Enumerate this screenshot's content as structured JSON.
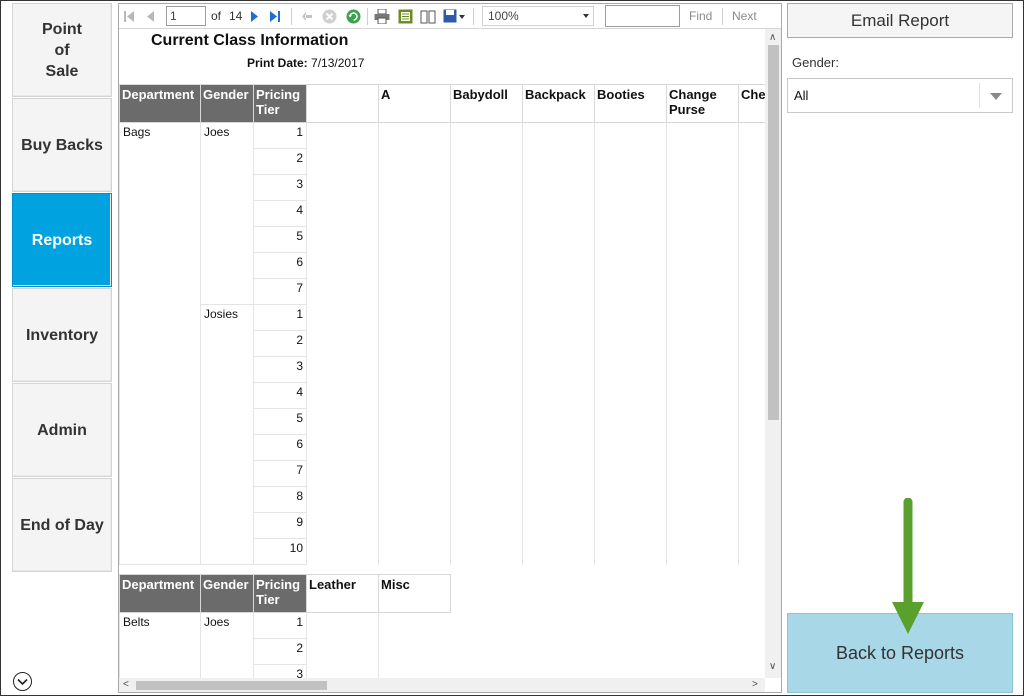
{
  "nav": {
    "items": [
      {
        "label": "Point\nof\nSale",
        "active": false
      },
      {
        "label": "Buy Backs",
        "active": false
      },
      {
        "label": "Reports",
        "active": true
      },
      {
        "label": "Inventory",
        "active": false
      },
      {
        "label": "Admin",
        "active": false
      },
      {
        "label": "End of Day",
        "active": false
      }
    ],
    "expand_icon": "chevron-down-circle-icon"
  },
  "toolbar": {
    "page_value": "1",
    "of_label": "of",
    "page_total": "14",
    "zoom_value": "100%",
    "find_label": "Find",
    "next_label": "Next",
    "icons": [
      "first-page-icon",
      "prev-page-icon",
      "next-page-icon",
      "last-page-icon",
      "back-icon",
      "stop-icon",
      "refresh-icon",
      "print-icon",
      "print-layout-icon",
      "page-setup-icon",
      "export-icon"
    ]
  },
  "report": {
    "title": "Current Class Information",
    "print_date_label": "Print Date:",
    "print_date": "7/13/2017",
    "table1": {
      "headers": [
        "Department",
        "Gender",
        "Pricing Tier",
        "",
        "A",
        "Babydoll",
        "Backpack",
        "Booties",
        "Change Purse",
        "Chec k Co"
      ],
      "department": "Bags",
      "groups": [
        {
          "gender": "Joes",
          "tiers": [
            "1",
            "2",
            "3",
            "4",
            "5",
            "6",
            "7"
          ]
        },
        {
          "gender": "Josies",
          "tiers": [
            "1",
            "2",
            "3",
            "4",
            "5",
            "6",
            "7",
            "8",
            "9",
            "10"
          ]
        }
      ]
    },
    "table2": {
      "headers": [
        "Department",
        "Gender",
        "Pricing Tier",
        "Leather",
        "Misc"
      ],
      "department": "Belts",
      "groups": [
        {
          "gender": "Joes",
          "tiers": [
            "1",
            "2",
            "3"
          ]
        }
      ]
    }
  },
  "right_panel": {
    "email_button": "Email Report",
    "gender_label": "Gender:",
    "gender_value": "All",
    "back_button": "Back to Reports"
  },
  "colors": {
    "nav_active": "#00a3e0",
    "table_header": "#6b6b6b",
    "back_button": "#a8d7e8",
    "annotation_arrow": "#5aa02c"
  }
}
